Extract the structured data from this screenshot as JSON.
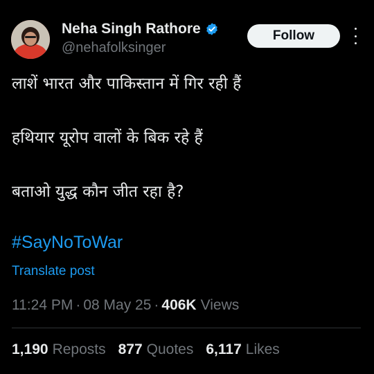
{
  "author": {
    "name": "Neha Singh Rathore",
    "handle": "@nehafolksinger",
    "verified": true
  },
  "follow_label": "Follow",
  "tweet_lines": [
    "लाशें भारत और पाकिस्तान में गिर रही हैं",
    "हथियार यूरोप वालों के बिक रहे हैं",
    "बताओ युद्ध कौन जीत रहा है?"
  ],
  "hashtag": "#SayNoToWar",
  "translate_label": "Translate post",
  "meta": {
    "time": "11:24 PM",
    "separator": "·",
    "date": "08 May 25",
    "views_count": "406K",
    "views_label": "Views"
  },
  "stats": {
    "reposts_count": "1,190",
    "reposts_label": "Reposts",
    "quotes_count": "877",
    "quotes_label": "Quotes",
    "likes_count": "6,117",
    "likes_label": "Likes"
  },
  "colors": {
    "background": "#000000",
    "text": "#e7e9ea",
    "muted": "#71767b",
    "link": "#1d9bf0",
    "verified_badge": "#1d9bf0"
  }
}
